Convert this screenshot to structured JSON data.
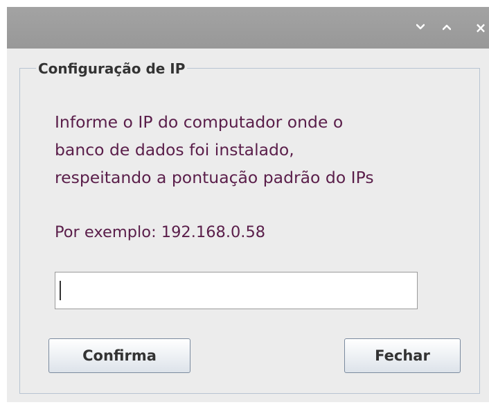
{
  "titlebar": {
    "minimize_icon": "chevron-down-icon",
    "maximize_icon": "chevron-up-icon",
    "close_icon": "close-icon",
    "close_glyph": "×"
  },
  "group": {
    "title": "Configuração de IP"
  },
  "info": {
    "lines": [
      "Informe o IP do computador onde o",
      "banco de dados foi instalado,",
      "respeitando a pontuação padrão do IPs"
    ],
    "example": "Por exemplo: 192.168.0.58"
  },
  "ip_field": {
    "value": "",
    "placeholder": ""
  },
  "buttons": {
    "confirm": "Confirma",
    "close": "Fechar"
  },
  "colors": {
    "titlebar": "#9e9e9e",
    "info_text": "#5a1e4a",
    "group_border": "#b8c4d2",
    "window_bg": "#ececec"
  }
}
